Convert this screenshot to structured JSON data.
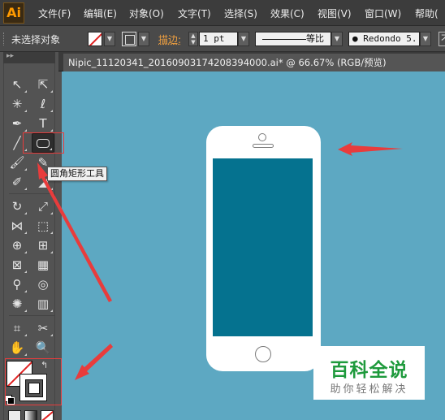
{
  "app": {
    "logo": "Ai"
  },
  "menu": {
    "items": [
      "文件(F)",
      "编辑(E)",
      "对象(O)",
      "文字(T)",
      "选择(S)",
      "效果(C)",
      "视图(V)",
      "窗口(W)",
      "帮助("
    ]
  },
  "control": {
    "selection_status": "未选择对象",
    "stroke_label": "描边:",
    "stroke_weight": "1 pt",
    "stroke_profile": "等比",
    "brush": "● Redondo 5...",
    "cut_label": "不"
  },
  "toolbar": {
    "header": "▸▸",
    "tooltip": "圆角矩形工具",
    "active_tool": "rounded-rectangle-tool",
    "colors": {
      "fill": "#ffffff",
      "stroke_none": "#e02020"
    }
  },
  "document": {
    "tab_title": "Nipic_11120341_20160903174208394000.ai* @ 66.67% (RGB/预览)",
    "zoom": "66.67%",
    "color_mode": "RGB/预览"
  },
  "colors": {
    "canvas": "#5da8c2",
    "phone_body": "#ffffff",
    "phone_screen": "#05728f",
    "annotation": "#e83c3c",
    "watermark_green": "#1e9a3c"
  },
  "watermark": {
    "title": "百科全说",
    "subtitle": "助你轻松解决"
  }
}
